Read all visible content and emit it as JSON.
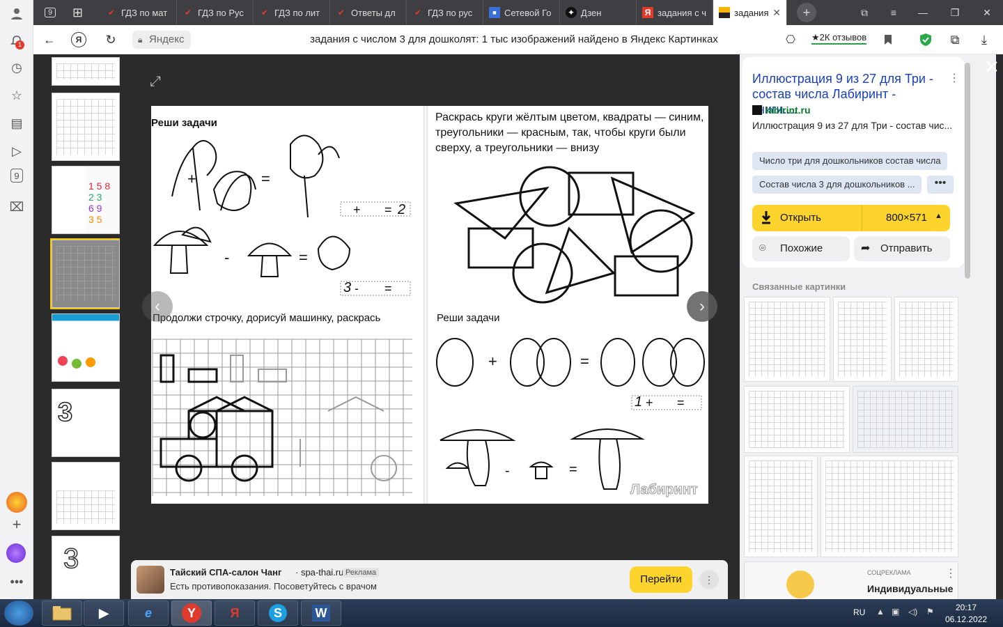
{
  "sidebar": {
    "notification_count": "1",
    "nine_label": "9"
  },
  "tabs": [
    {
      "label": "ГДЗ по мат",
      "icon": "gdz-icon"
    },
    {
      "label": "ГДЗ по Рус",
      "icon": "gdz-icon"
    },
    {
      "label": "ГДЗ по лит",
      "icon": "gdz-icon"
    },
    {
      "label": "Ответы дл",
      "icon": "gdz-icon"
    },
    {
      "label": "ГДЗ по рус",
      "icon": "gdz-icon"
    },
    {
      "label": "Сетевой Го",
      "icon": "school-icon"
    },
    {
      "label": "Дзен",
      "icon": "zen-icon"
    },
    {
      "label": "задания с ч",
      "icon": "yandex-icon"
    },
    {
      "label": "задания",
      "icon": "images-icon"
    }
  ],
  "tab_counter": "9",
  "address": {
    "site": "Яндекс",
    "title": "задания с числом 3 для дошколят: 1 тыс изображений найдено в Яндекс Картинках",
    "reviews": "★2К отзывов",
    "extension_count": "3"
  },
  "image": {
    "left_title": "Реши задачи",
    "right_task": "Раскрась круги жёлтым цветом, квадраты — синим, треугольники — красным, так, чтобы круги были сверху, а треугольники — внизу",
    "left_task2": "Продолжи строчку, дорисуй машинку, раскрась",
    "right_task2": "Реши задачи",
    "eq1_result": "2",
    "eq2_first": "3",
    "eq3_first": "1",
    "watermark": "Лабиринт"
  },
  "ad": {
    "title": "Тайский СПА-салон Чанг",
    "domain": "· spa-thai.ru",
    "label": "Реклама",
    "text": "Есть противопоказания. Посоветуйтесь с врачом",
    "button": "Перейти"
  },
  "panel": {
    "title": "Иллюстрация 9 из 27 для Три - состав числа Лабиринт - книги....",
    "source": "labirint.ru",
    "desc": "Иллюстрация 9 из 27 для Три - состав чис...",
    "tags": [
      "Число три для дошкольников состав числа",
      "Состав числа 3 для дошкольников ..."
    ],
    "open": "Открыть",
    "size": "800×571",
    "similar": "Похожие",
    "share": "Отправить",
    "related": "Связанные картинки",
    "ad_small_label": "СОЦРЕКЛАМА",
    "ad_small_title": "Индивидуальные"
  },
  "taskbar": {
    "lang": "RU",
    "time": "20:17",
    "date": "06.12.2022"
  }
}
